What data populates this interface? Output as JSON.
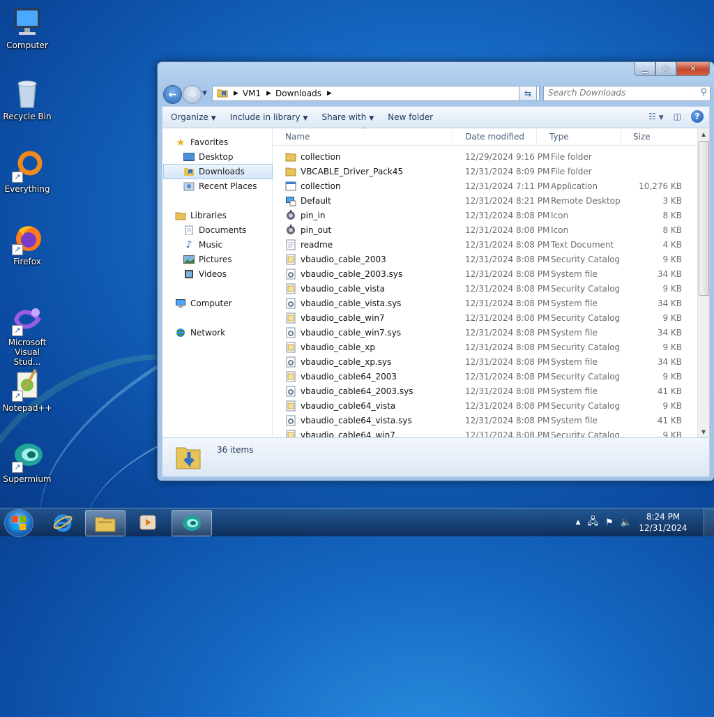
{
  "desktop": {
    "icons": [
      {
        "label": "Computer"
      },
      {
        "label": "Recycle Bin"
      },
      {
        "label": "Everything"
      },
      {
        "label": "Firefox"
      },
      {
        "label": "Microsoft Visual Stud..."
      },
      {
        "label": "Notepad++"
      },
      {
        "label": "Supermium"
      }
    ]
  },
  "window": {
    "address": {
      "segments": [
        "VM1",
        "Downloads"
      ]
    },
    "search": {
      "placeholder": "Search Downloads"
    },
    "toolbar": {
      "organize": "Organize",
      "include": "Include in library",
      "share": "Share with",
      "new_folder": "New folder"
    },
    "nav": {
      "favorites": "Favorites",
      "desktop": "Desktop",
      "downloads": "Downloads",
      "recent": "Recent Places",
      "libraries": "Libraries",
      "documents": "Documents",
      "music": "Music",
      "pictures": "Pictures",
      "videos": "Videos",
      "computer": "Computer",
      "network": "Network"
    },
    "columns": {
      "name": "Name",
      "date": "Date modified",
      "type": "Type",
      "size": "Size"
    },
    "files": [
      {
        "name": "collection",
        "date": "12/29/2024 9:16 PM",
        "type": "File folder",
        "size": "",
        "icon": "folder"
      },
      {
        "name": "VBCABLE_Driver_Pack45",
        "date": "12/31/2024 8:09 PM",
        "type": "File folder",
        "size": "",
        "icon": "folder"
      },
      {
        "name": "collection",
        "date": "12/31/2024 7:11 PM",
        "type": "Application",
        "size": "10,276 KB",
        "icon": "app"
      },
      {
        "name": "Default",
        "date": "12/31/2024 8:21 PM",
        "type": "Remote Desktop ...",
        "size": "3 KB",
        "icon": "rdp"
      },
      {
        "name": "pin_in",
        "date": "12/31/2024 8:08 PM",
        "type": "Icon",
        "size": "8 KB",
        "icon": "ico"
      },
      {
        "name": "pin_out",
        "date": "12/31/2024 8:08 PM",
        "type": "Icon",
        "size": "8 KB",
        "icon": "ico"
      },
      {
        "name": "readme",
        "date": "12/31/2024 8:08 PM",
        "type": "Text Document",
        "size": "4 KB",
        "icon": "txt"
      },
      {
        "name": "vbaudio_cable_2003",
        "date": "12/31/2024 8:08 PM",
        "type": "Security Catalog",
        "size": "9 KB",
        "icon": "cat"
      },
      {
        "name": "vbaudio_cable_2003.sys",
        "date": "12/31/2024 8:08 PM",
        "type": "System file",
        "size": "34 KB",
        "icon": "sys"
      },
      {
        "name": "vbaudio_cable_vista",
        "date": "12/31/2024 8:08 PM",
        "type": "Security Catalog",
        "size": "9 KB",
        "icon": "cat"
      },
      {
        "name": "vbaudio_cable_vista.sys",
        "date": "12/31/2024 8:08 PM",
        "type": "System file",
        "size": "34 KB",
        "icon": "sys"
      },
      {
        "name": "vbaudio_cable_win7",
        "date": "12/31/2024 8:08 PM",
        "type": "Security Catalog",
        "size": "9 KB",
        "icon": "cat"
      },
      {
        "name": "vbaudio_cable_win7.sys",
        "date": "12/31/2024 8:08 PM",
        "type": "System file",
        "size": "34 KB",
        "icon": "sys"
      },
      {
        "name": "vbaudio_cable_xp",
        "date": "12/31/2024 8:08 PM",
        "type": "Security Catalog",
        "size": "9 KB",
        "icon": "cat"
      },
      {
        "name": "vbaudio_cable_xp.sys",
        "date": "12/31/2024 8:08 PM",
        "type": "System file",
        "size": "34 KB",
        "icon": "sys"
      },
      {
        "name": "vbaudio_cable64_2003",
        "date": "12/31/2024 8:08 PM",
        "type": "Security Catalog",
        "size": "9 KB",
        "icon": "cat"
      },
      {
        "name": "vbaudio_cable64_2003.sys",
        "date": "12/31/2024 8:08 PM",
        "type": "System file",
        "size": "41 KB",
        "icon": "sys"
      },
      {
        "name": "vbaudio_cable64_vista",
        "date": "12/31/2024 8:08 PM",
        "type": "Security Catalog",
        "size": "9 KB",
        "icon": "cat"
      },
      {
        "name": "vbaudio_cable64_vista.sys",
        "date": "12/31/2024 8:08 PM",
        "type": "System file",
        "size": "41 KB",
        "icon": "sys"
      },
      {
        "name": "vbaudio_cable64_win7",
        "date": "12/31/2024 8:08 PM",
        "type": "Security Catalog",
        "size": "9 KB",
        "icon": "cat"
      }
    ],
    "status": {
      "count": "36 items"
    }
  },
  "taskbar": {
    "time": "8:24 PM",
    "date": "12/31/2024"
  },
  "colors": {
    "accent": "#1466c0",
    "selection": "#d3e5f9"
  }
}
